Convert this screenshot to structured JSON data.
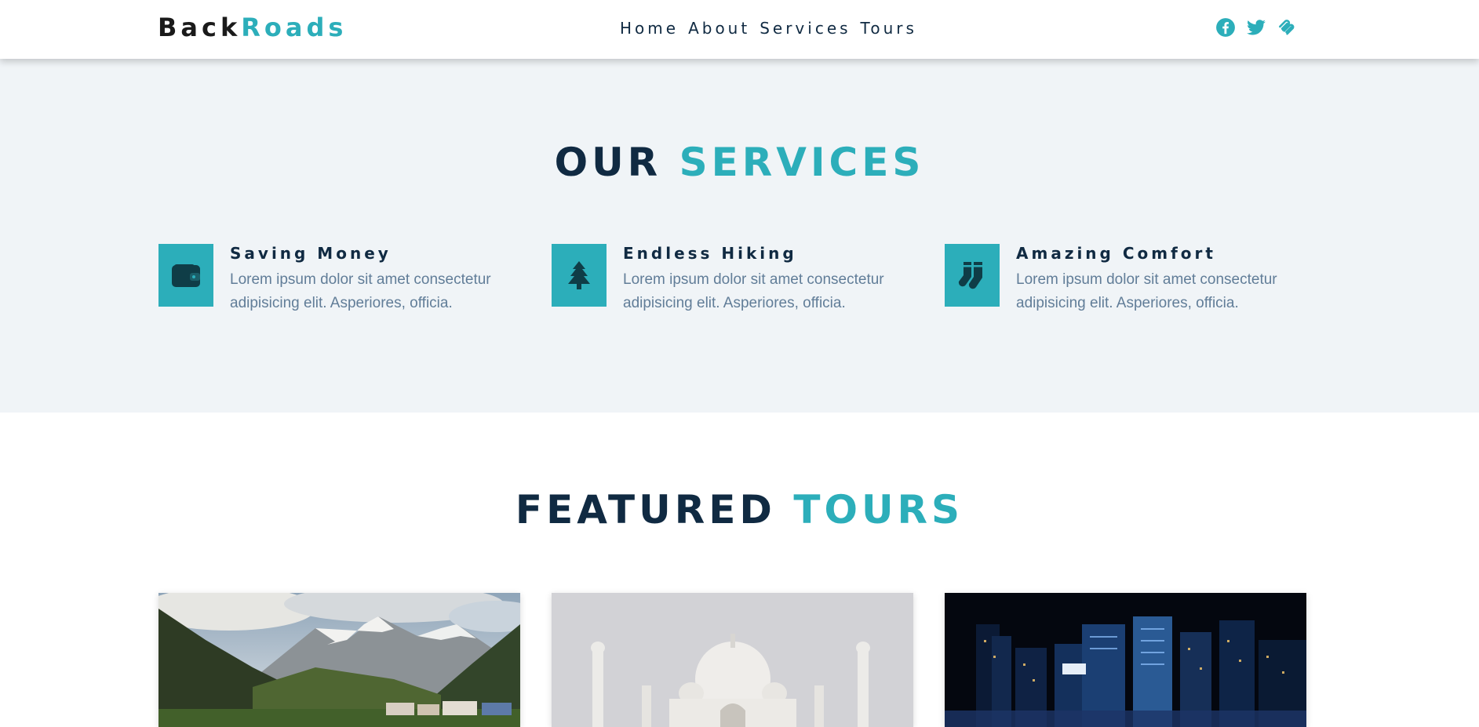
{
  "logo": {
    "part1": "Back",
    "part2": "Roads"
  },
  "nav": {
    "links": [
      "Home",
      "About",
      "Services",
      "Tours"
    ]
  },
  "socials": [
    "facebook-icon",
    "twitter-icon",
    "squarespace-icon"
  ],
  "services": {
    "title_part1": "OUR",
    "title_part2": "SERVICES",
    "items": [
      {
        "icon": "wallet-icon",
        "title": "Saving Money",
        "text": "Lorem ipsum dolor sit amet consectetur adipisicing elit. Asperiores, officia."
      },
      {
        "icon": "tree-icon",
        "title": "Endless Hiking",
        "text": "Lorem ipsum dolor sit amet consectetur adipisicing elit. Asperiores, officia."
      },
      {
        "icon": "socks-icon",
        "title": "Amazing Comfort",
        "text": "Lorem ipsum dolor sit amet consectetur adipisicing elit. Asperiores, officia."
      }
    ]
  },
  "tours": {
    "title_part1": "FEATURED",
    "title_part2": "TOURS",
    "cards": [
      {
        "image": "mountain-village-image"
      },
      {
        "image": "taj-mahal-image"
      },
      {
        "image": "night-city-image"
      }
    ]
  },
  "colors": {
    "accent": "#2caeba",
    "dark": "#102a42",
    "text": "#617d98",
    "section_bg": "#f0f4f7"
  }
}
